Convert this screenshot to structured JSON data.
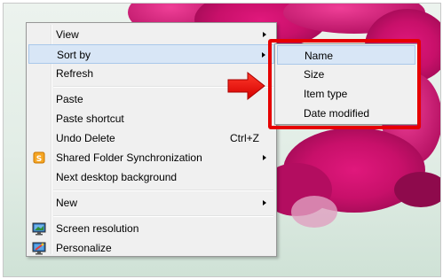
{
  "main_menu": {
    "items": [
      {
        "label": "View",
        "submenu": true
      },
      {
        "label": "Sort by",
        "submenu": true,
        "highlighted": true
      },
      {
        "label": "Refresh"
      },
      {
        "label": "Paste"
      },
      {
        "label": "Paste shortcut"
      },
      {
        "label": "Undo Delete",
        "shortcut": "Ctrl+Z"
      },
      {
        "label": "Shared Folder Synchronization",
        "submenu": true,
        "icon": "shared-folder-sync-icon"
      },
      {
        "label": "Next desktop background"
      },
      {
        "label": "New",
        "submenu": true
      },
      {
        "label": "Screen resolution",
        "icon": "screen-resolution-icon"
      },
      {
        "label": "Personalize",
        "icon": "personalize-icon"
      }
    ]
  },
  "sort_submenu": {
    "items": [
      {
        "label": "Name",
        "highlighted": true
      },
      {
        "label": "Size"
      },
      {
        "label": "Item type"
      },
      {
        "label": "Date modified"
      }
    ]
  },
  "annotation": {
    "highlight_color": "#e60000",
    "arrow_icon": "red-arrow-right-icon"
  },
  "colors": {
    "menu_background": "#f0f0f0",
    "hover_background": "#d8e6f6",
    "hover_border": "#a9c8ea"
  }
}
